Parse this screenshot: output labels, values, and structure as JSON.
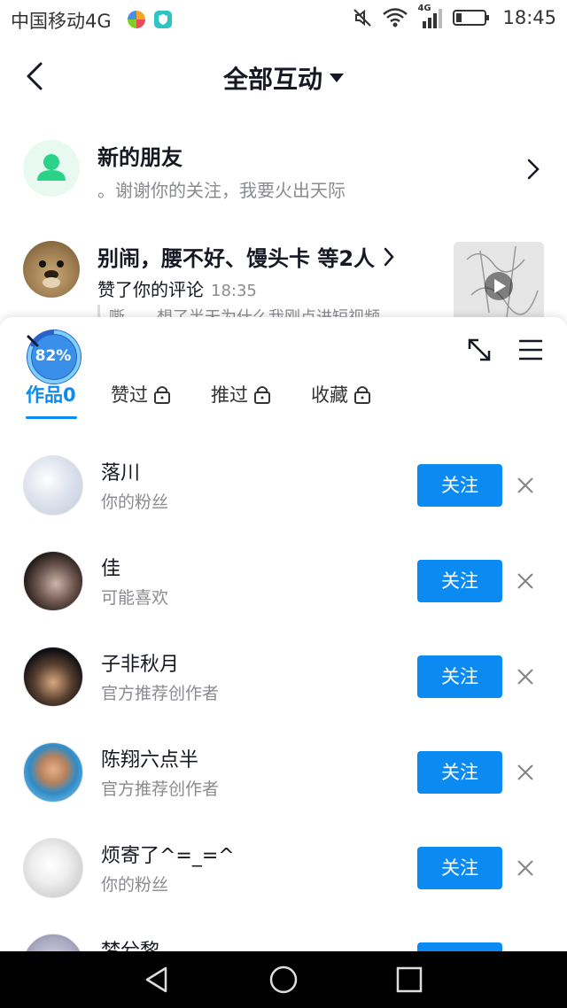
{
  "status_bar": {
    "carrier": "中国移动4G",
    "network_badge": "4G",
    "time": "18:45",
    "icons": [
      "app-color-icon",
      "shield-app-icon",
      "mute-icon",
      "wifi-icon",
      "signal-icon",
      "battery-icon"
    ]
  },
  "header": {
    "title": "全部互动"
  },
  "notifications": [
    {
      "title": "新的朋友",
      "subtitle": "。谢谢你的关注，我要火出天际"
    },
    {
      "title": "别闹，腰不好、馒头卡 等2人",
      "action": "赞了你的评论",
      "time": "18:35",
      "quote": "嘶……想了半天为什么我刚点进短视频"
    }
  ],
  "sheet": {
    "progress_label": "82%",
    "progress": 0.82,
    "tabs": [
      {
        "label": "作品0",
        "locked": false,
        "active": true
      },
      {
        "label": "赞过",
        "locked": true,
        "active": false
      },
      {
        "label": "推过",
        "locked": true,
        "active": false
      },
      {
        "label": "收藏",
        "locked": true,
        "active": false
      }
    ],
    "recommendations": [
      {
        "name": "落川",
        "reason": "你的粉丝",
        "button": "关注"
      },
      {
        "name": "佳",
        "reason": "可能喜欢",
        "button": "关注"
      },
      {
        "name": "子非秋月",
        "reason": "官方推荐创作者",
        "button": "关注"
      },
      {
        "name": "陈翔六点半",
        "reason": "官方推荐创作者",
        "button": "关注"
      },
      {
        "name": "烦寄了^=_=^",
        "reason": "你的粉丝",
        "button": "关注"
      },
      {
        "name": "梦兮黎",
        "reason": "",
        "button": "关注"
      }
    ]
  },
  "colors": {
    "accent": "#0b8bf2",
    "friend_icon": "#2bd28a",
    "text_primary": "#161823",
    "text_secondary": "#8a8b91"
  }
}
